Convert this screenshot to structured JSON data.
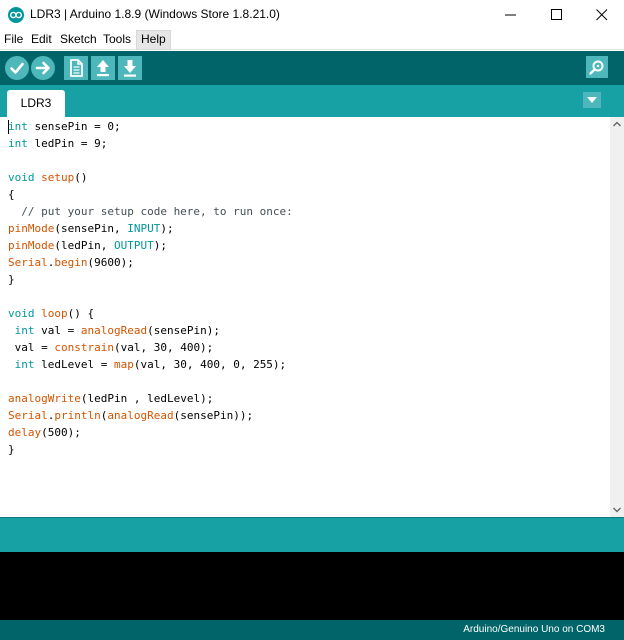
{
  "window": {
    "title": "LDR3 | Arduino 1.8.9 (Windows Store 1.8.21.0)",
    "app_icon": "arduino-infinity-icon",
    "controls": [
      "minimize-icon",
      "maximize-icon",
      "close-icon"
    ]
  },
  "menu": {
    "file": "File",
    "edit": "Edit",
    "sketch": "Sketch",
    "tools": "Tools",
    "help": "Help"
  },
  "toolbar": {
    "buttons": [
      "verify-icon",
      "upload-icon",
      "new-icon",
      "open-icon",
      "save-icon"
    ],
    "serial_monitor": "serial-monitor-icon"
  },
  "tabs": [
    {
      "label": "LDR3"
    }
  ],
  "editor": {
    "lines": [
      [
        {
          "t": "int",
          "c": "kw-type"
        },
        {
          "t": " sensePin = 0;"
        }
      ],
      [
        {
          "t": "int",
          "c": "kw-type"
        },
        {
          "t": " ledPin = 9;"
        }
      ],
      [],
      [
        {
          "t": "void",
          "c": "kw-type"
        },
        {
          "t": " "
        },
        {
          "t": "setup",
          "c": "kw-func"
        },
        {
          "t": "()"
        }
      ],
      [
        {
          "t": "{"
        }
      ],
      [
        {
          "t": "  // put your setup code here, to run once:",
          "c": "comment"
        }
      ],
      [
        {
          "t": "pinMode",
          "c": "kw-func"
        },
        {
          "t": "(sensePin, "
        },
        {
          "t": "INPUT",
          "c": "kw-const"
        },
        {
          "t": ");"
        }
      ],
      [
        {
          "t": "pinMode",
          "c": "kw-func"
        },
        {
          "t": "(ledPin, "
        },
        {
          "t": "OUTPUT",
          "c": "kw-const"
        },
        {
          "t": ");"
        }
      ],
      [
        {
          "t": "Serial",
          "c": "kw-func"
        },
        {
          "t": "."
        },
        {
          "t": "begin",
          "c": "kw-func"
        },
        {
          "t": "(9600);"
        }
      ],
      [
        {
          "t": "}"
        }
      ],
      [],
      [
        {
          "t": "void",
          "c": "kw-type"
        },
        {
          "t": " "
        },
        {
          "t": "loop",
          "c": "kw-func"
        },
        {
          "t": "() {"
        }
      ],
      [
        {
          "t": " "
        },
        {
          "t": "int",
          "c": "kw-type"
        },
        {
          "t": " val = "
        },
        {
          "t": "analogRead",
          "c": "kw-func"
        },
        {
          "t": "(sensePin);"
        }
      ],
      [
        {
          "t": " val = "
        },
        {
          "t": "constrain",
          "c": "kw-func"
        },
        {
          "t": "(val, 30, 400);"
        }
      ],
      [
        {
          "t": " "
        },
        {
          "t": "int",
          "c": "kw-type"
        },
        {
          "t": " ledLevel = "
        },
        {
          "t": "map",
          "c": "kw-func"
        },
        {
          "t": "(val, 30, 400, 0, 255);"
        }
      ],
      [],
      [
        {
          "t": "analogWrite",
          "c": "kw-func"
        },
        {
          "t": "(ledPin , ledLevel);"
        }
      ],
      [
        {
          "t": "Serial",
          "c": "kw-func"
        },
        {
          "t": "."
        },
        {
          "t": "println",
          "c": "kw-func"
        },
        {
          "t": "("
        },
        {
          "t": "analogRead",
          "c": "kw-func"
        },
        {
          "t": "(sensePin));"
        }
      ],
      [
        {
          "t": "delay",
          "c": "kw-func"
        },
        {
          "t": "(500);"
        }
      ],
      [
        {
          "t": "}"
        }
      ]
    ]
  },
  "status": {
    "board": "Arduino/Genuino Uno on COM3"
  },
  "colors": {
    "teal_dark": "#006468",
    "teal": "#17a1a5",
    "button": "#4db7bb",
    "keyword": "#00979c",
    "function": "#d35400"
  }
}
